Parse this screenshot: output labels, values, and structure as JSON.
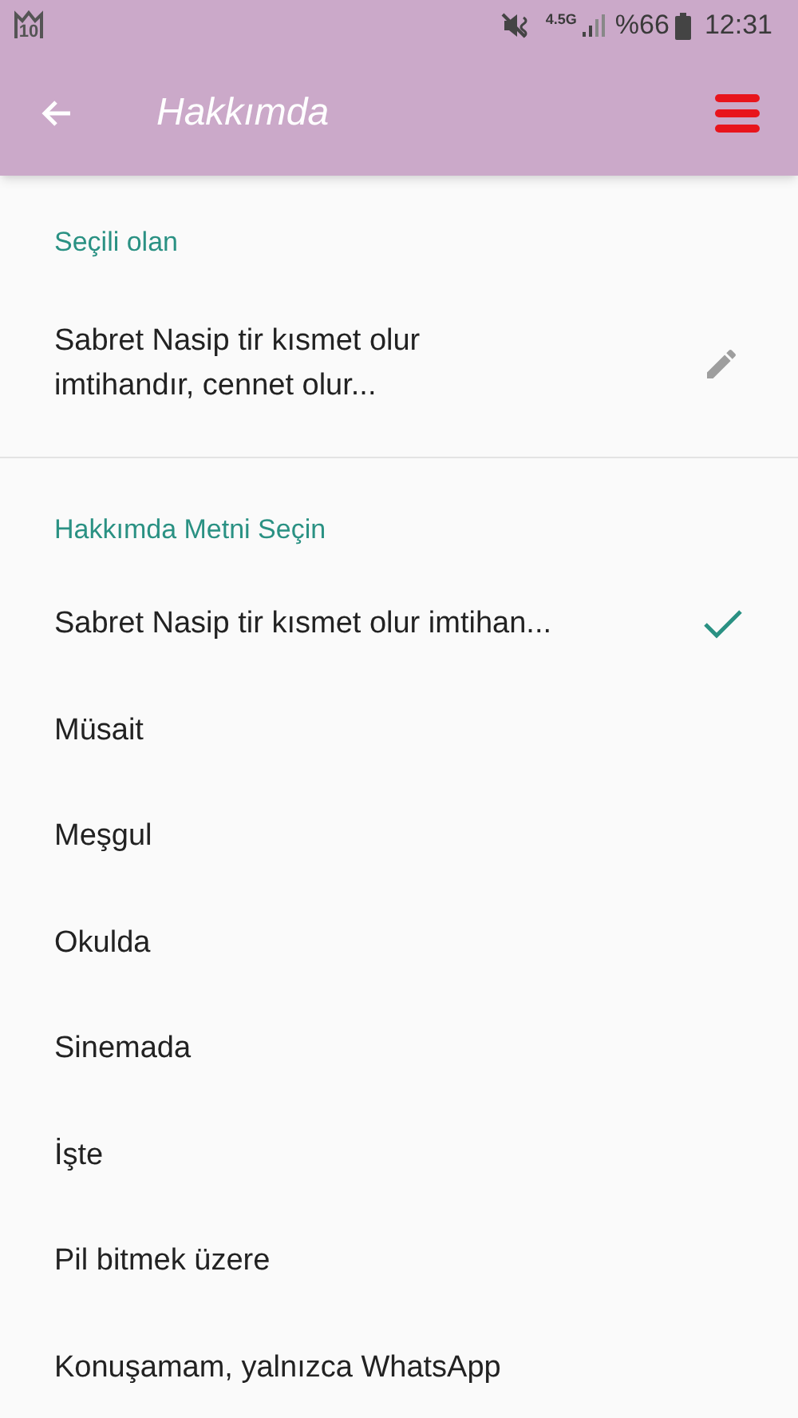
{
  "status_bar": {
    "notification_badge": "10",
    "network": "4.5G",
    "battery": "%66",
    "time": "12:31"
  },
  "toolbar": {
    "title": "Hakkımda"
  },
  "current": {
    "header": "Seçili olan",
    "text": "Sabret Nasip tir kısmet olur\nimtihandır, cennet olur..."
  },
  "options": {
    "header": "Hakkımda Metni Seçin",
    "items": [
      {
        "label": "Sabret Nasip tir kısmet olur imtihan...",
        "selected": true
      },
      {
        "label": "Müsait",
        "selected": false
      },
      {
        "label": "Meşgul",
        "selected": false
      },
      {
        "label": "Okulda",
        "selected": false
      },
      {
        "label": "Sinemada",
        "selected": false
      },
      {
        "label": "İşte",
        "selected": false
      },
      {
        "label": "Pil bitmek üzere",
        "selected": false
      },
      {
        "label": "Konuşamam, yalnızca WhatsApp",
        "selected": false
      }
    ]
  }
}
